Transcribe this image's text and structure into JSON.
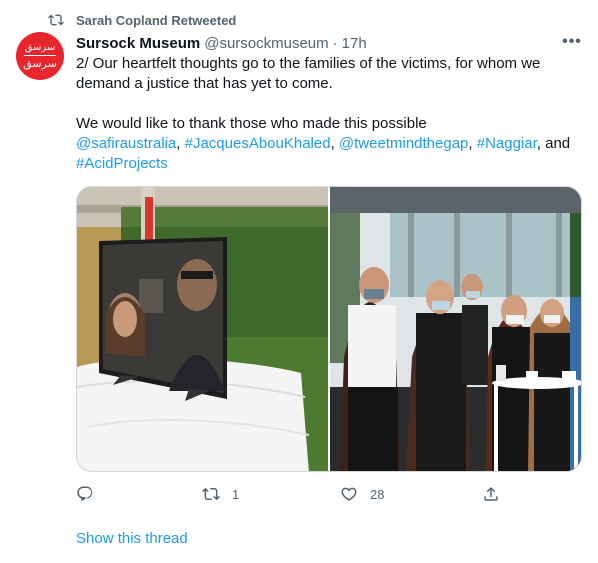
{
  "retweet": {
    "label": "Sarah Copland Retweeted",
    "icon": "retweet-icon"
  },
  "author": {
    "avatar_top": "ﺳﺮﺳﻖ",
    "avatar_bottom": "سرسق",
    "avatar_color": "#e8262e",
    "name": "Sursock Museum",
    "handle": "@sursockmuseum",
    "separator": "·",
    "time": "17h"
  },
  "more_icon": "more-options-icon",
  "more_label": "•••",
  "tweet": {
    "line1": "2/ Our heartfelt thoughts go to the families of the victims, for whom we demand a justice that has yet to come.",
    "line2": "We would like to thank those who made this possible",
    "mentions": [
      {
        "text": "@safiraustralia",
        "sep": ", "
      },
      {
        "text": "#JacquesAbouKhaled",
        "sep": ", "
      },
      {
        "text": "@tweetmindthegap",
        "sep": ", "
      },
      {
        "text": "#Naggiar",
        "sep": ", and "
      },
      {
        "text": "#AcidProjects",
        "sep": ""
      }
    ]
  },
  "actions": {
    "reply": {
      "icon": "reply-icon",
      "count": ""
    },
    "retweet": {
      "icon": "retweet-icon",
      "count": "1"
    },
    "like": {
      "icon": "heart-icon",
      "count": "28"
    },
    "share": {
      "icon": "share-icon",
      "count": ""
    }
  },
  "show_thread": "Show this thread",
  "colors": {
    "accent": "#1d9bf0",
    "secondary_text": "#536471",
    "primary_text": "#0f1419"
  }
}
